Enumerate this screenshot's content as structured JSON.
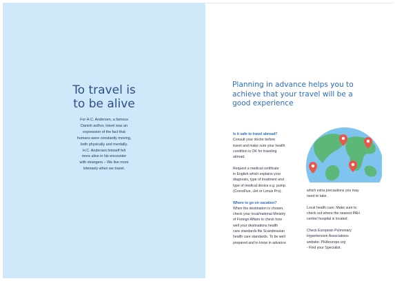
{
  "left_page": {
    "title_lines": [
      "To travel is",
      "to be alive"
    ],
    "body_lines": [
      "For H.C. Andersen, a famous",
      "Danish author, travel was an",
      "expression of the fact that",
      "humans were constantly moving,",
      "both physically and mentally.",
      "H.C. Andersen himself felt",
      "more alive in his encounter",
      "with strangers – We live more",
      "intensely when we travel."
    ]
  },
  "right_page": {
    "heading_lines": [
      "Planning in advance helps you to",
      "achieve that your travel will be a",
      "good experience"
    ],
    "col1": {
      "sub1": "Is it safe to travel abroad?",
      "p1_lines": [
        "Consult your doctor before",
        "travel and make sure your health",
        "condition is OK for traveling",
        "abroad."
      ],
      "p2_lines": [
        "Request a medical certificate",
        "in English which explains your",
        "diagnosis, type of treatment and",
        "type of medical device e.g. pump",
        "(CronoFive, iJet or Lenus Pro)."
      ],
      "sub2": "Where to go on vacation?",
      "p3_lines": [
        "When the destination is chosen,",
        "check your local/national Ministry",
        "of Foreign Affairs to check how",
        "well your destinations health",
        "care standards fits Scandinavian",
        "health care standards. To be well",
        "prepared and to know in advance"
      ]
    },
    "col2": {
      "p1_lines": [
        "which extra precautions you may",
        "need to take."
      ],
      "p2_lines": [
        "Local health care: Make sure to",
        "check out where the nearest PAH",
        "centre/ hospital is located."
      ],
      "p3_lines": [
        "Check European Pulmonary",
        "Hypertension Associations",
        "website: PHAeurope.org",
        "- Find your Specialist."
      ]
    },
    "illustration": {
      "icon": "globe-with-location-pins-icon",
      "ocean_color": "#7fc3ef",
      "land_color": "#5cb878",
      "pin_color": "#e8574a"
    }
  }
}
